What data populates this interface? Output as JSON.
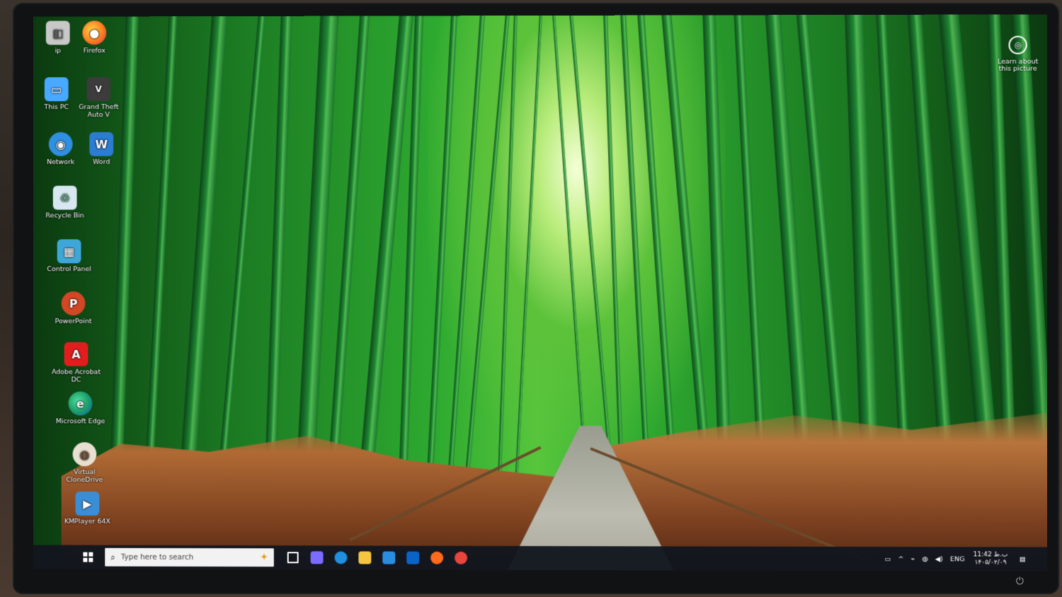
{
  "desktop": {
    "icons": [
      {
        "label": "ip",
        "icon": "user-folder-icon",
        "color": "#c8c8c8"
      },
      {
        "label": "Firefox",
        "icon": "firefox-icon",
        "color": "#ff7b1c"
      },
      {
        "label": "This PC",
        "icon": "computer-icon",
        "color": "#49a8ff"
      },
      {
        "label": "Grand Theft Auto V",
        "icon": "gta-v-icon",
        "color": "#3c3c3c"
      },
      {
        "label": "Network",
        "icon": "network-icon",
        "color": "#2f8fe0"
      },
      {
        "label": "Word",
        "icon": "word-icon",
        "color": "#2b7cd3"
      },
      {
        "label": "Recycle Bin",
        "icon": "recycle-bin-icon",
        "color": "#d8e8f0"
      },
      {
        "label": "Control Panel",
        "icon": "control-panel-icon",
        "color": "#3fa7d8"
      },
      {
        "label": "PowerPoint",
        "icon": "powerpoint-icon",
        "color": "#d24726"
      },
      {
        "label": "Adobe Acrobat DC",
        "icon": "acrobat-icon",
        "color": "#e01e1e"
      },
      {
        "label": "Microsoft Edge",
        "icon": "edge-icon",
        "color": "#1fa06b"
      },
      {
        "label": "Virtual CloneDrive",
        "icon": "clonedrive-icon",
        "color": "#e8e0d0"
      },
      {
        "label": "KMPlayer 64X",
        "icon": "kmplayer-icon",
        "color": "#3a8ed8"
      }
    ],
    "learn_about": "Learn about this picture"
  },
  "taskbar": {
    "search_placeholder": "Type here to search",
    "apps": [
      {
        "name": "task-view-icon",
        "color": "#ffffff"
      },
      {
        "name": "copilot-icon",
        "color": "#7b6cff"
      },
      {
        "name": "edge-taskbar-icon",
        "color": "#1f8fe0"
      },
      {
        "name": "file-explorer-icon",
        "color": "#f5c542"
      },
      {
        "name": "store-icon",
        "color": "#2a8ee0"
      },
      {
        "name": "outlook-icon",
        "color": "#0a64c8"
      },
      {
        "name": "firefox-taskbar-icon",
        "color": "#ff6a1c"
      },
      {
        "name": "chrome-icon",
        "color": "#e8453c"
      }
    ],
    "tray": {
      "language": "ENG",
      "time": "11:42 ب.ظ",
      "date": "۱۴۰۵/۰۲/۰۹"
    }
  },
  "colors": {
    "taskbar_bg": "#12161e",
    "accent": "#0078d4"
  }
}
